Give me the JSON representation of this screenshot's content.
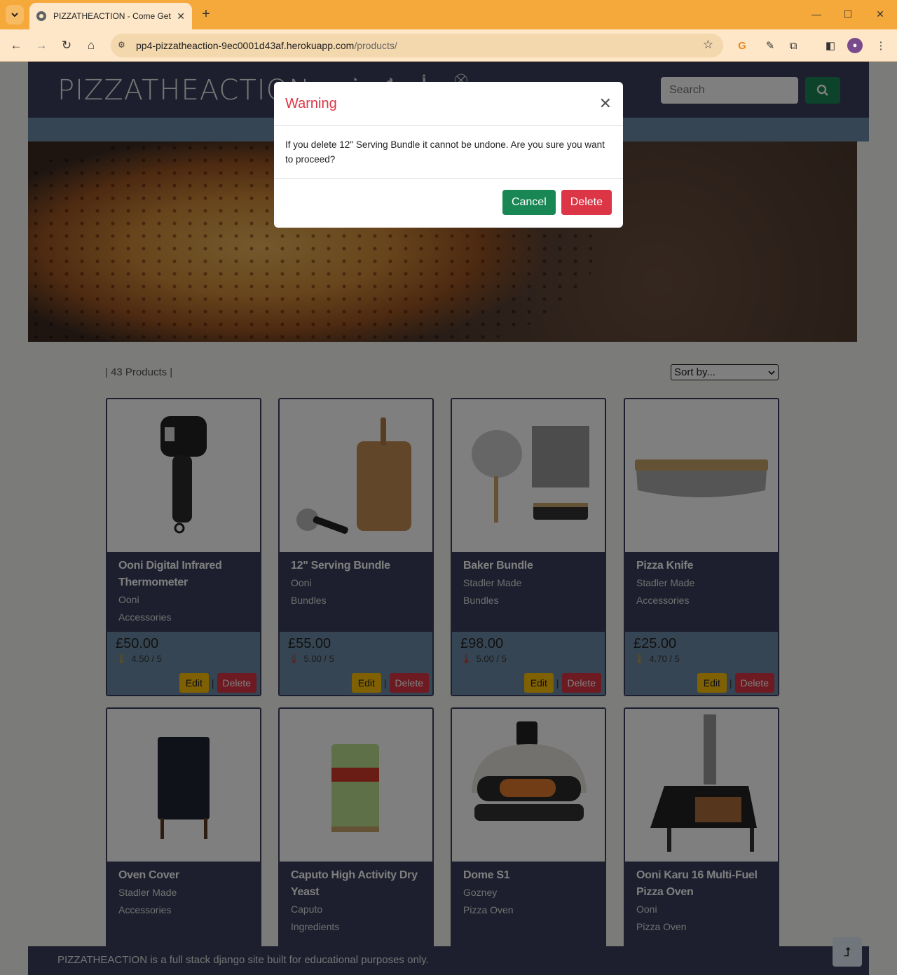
{
  "browser": {
    "tab_title": "PIZZATHEACTION - Come Get S",
    "url_host": "pp4-pizzatheaction-9ec0001d43af.herokuapp.com",
    "url_path": "/products/",
    "accent_color": "#f5a93a"
  },
  "site": {
    "logo": "PIZZATHEACTION",
    "search_placeholder": "Search",
    "products_count": "| 43 Products |",
    "sort_label": "Sort by...",
    "footer_text": "PIZZATHEACTION is a full stack django site built for educational purposes only."
  },
  "cards": {
    "edit_label": "Edit",
    "delete_label": "Delete",
    "separator": "|"
  },
  "products": [
    {
      "name": "Ooni Digital Infrared Thermometer",
      "brand": "Ooni",
      "category": "Accessories",
      "price": "£50.00",
      "rating": "4.50 / 5",
      "hot": false
    },
    {
      "name": "12\" Serving Bundle",
      "brand": "Ooni",
      "category": "Bundles",
      "price": "£55.00",
      "rating": "5.00 / 5",
      "hot": true
    },
    {
      "name": "Baker Bundle",
      "brand": "Stadler Made",
      "category": "Bundles",
      "price": "£98.00",
      "rating": "5.00 / 5",
      "hot": true
    },
    {
      "name": "Pizza Knife",
      "brand": "Stadler Made",
      "category": "Accessories",
      "price": "£25.00",
      "rating": "4.70 / 5",
      "hot": false
    },
    {
      "name": "Oven Cover",
      "brand": "Stadler Made",
      "category": "Accessories"
    },
    {
      "name": "Caputo High Activity Dry Yeast",
      "brand": "Caputo",
      "category": "Ingredients"
    },
    {
      "name": "Dome S1",
      "brand": "Gozney",
      "category": "Pizza Oven"
    },
    {
      "name": "Ooni Karu 16 Multi-Fuel Pizza Oven",
      "brand": "Ooni",
      "category": "Pizza Oven"
    }
  ],
  "modal": {
    "title": "Warning",
    "body": "If you delete 12\" Serving Bundle it cannot be undone. Are you sure you want to proceed?",
    "cancel_label": "Cancel",
    "delete_label": "Delete"
  }
}
